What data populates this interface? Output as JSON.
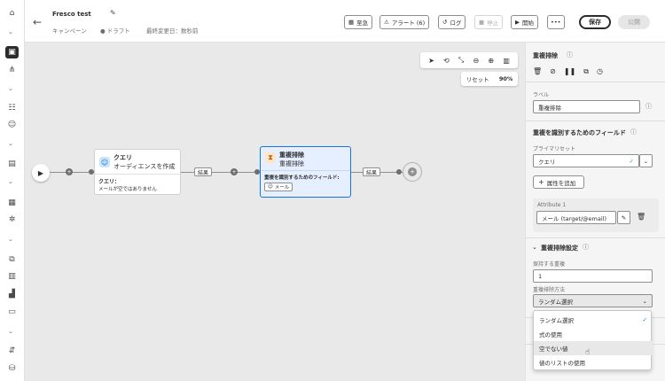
{
  "header": {
    "title": "Fresco test",
    "breadcrumb": "キャンペーン",
    "status": "ドラフト",
    "last_modified": "最終変更日：数秒前",
    "buttons": {
      "schedule": "至急",
      "alerts": "アラート (6)",
      "log": "ログ",
      "stop": "停止",
      "start": "開始",
      "more": "•••",
      "save": "保存",
      "publish": "公開"
    }
  },
  "canvas": {
    "zoom_reset": "リセット",
    "zoom_level": "90%",
    "query_node": {
      "title": "クエリ",
      "subtitle": "オーディエンスを作成",
      "body_label": "クエリ：",
      "body_text": "メールが空ではありません"
    },
    "dedup_node": {
      "title": "重複排除",
      "subtitle": "重複排除",
      "body_label": "重複を識別するためのフィールド:",
      "field_tag": "メール"
    },
    "tag1": "結果",
    "tag2": "結果"
  },
  "panel": {
    "title": "重複排除",
    "label_caption": "ラベル",
    "label_value": "重複排除",
    "fields_section": "重複を識別するためのフィールド",
    "preset_caption": "プライマリセット",
    "preset_value": "クエリ",
    "add_attribute": "属性を追加",
    "attribute_caption": "Attribute 1",
    "attribute_value": "メール (target/@email)",
    "settings_section": "重複排除設定",
    "keep_caption": "保持する重複",
    "keep_value": "1",
    "method_caption": "重複排除方法",
    "method_value": "ランダム選択"
  },
  "dropdown": {
    "options": [
      "ランダム選択",
      "式の使用",
      "空でない値",
      "値のリストの使用"
    ],
    "selected_index": 0,
    "hover_index": 2
  },
  "colors": {
    "accent_blue": "#1473e6",
    "node_selected_bg": "#e5efff",
    "canvas_bg": "#e9e9e9"
  }
}
